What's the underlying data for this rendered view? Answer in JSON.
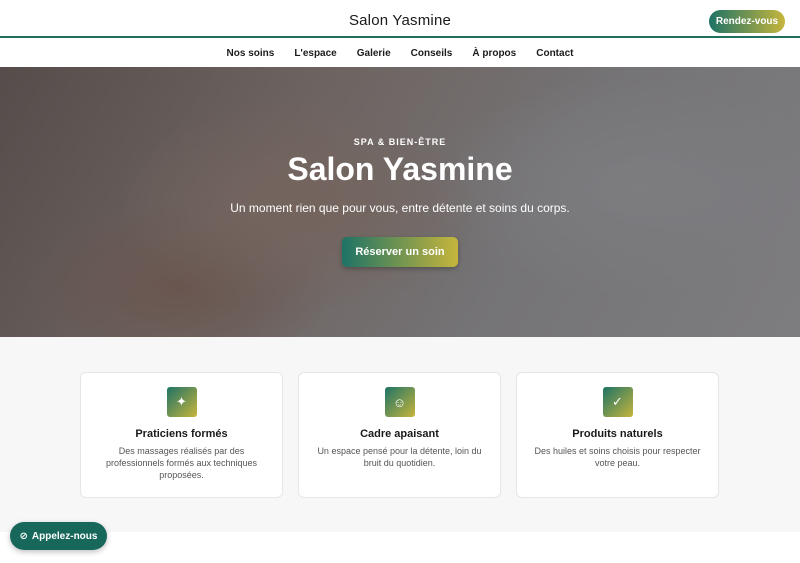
{
  "header": {
    "brand": "Salon Yasmine",
    "cta_label": "Rendez-vous"
  },
  "nav": {
    "items": [
      {
        "label": "Nos soins"
      },
      {
        "label": "L'espace"
      },
      {
        "label": "Galerie"
      },
      {
        "label": "Conseils"
      },
      {
        "label": "À propos"
      },
      {
        "label": "Contact"
      }
    ]
  },
  "hero": {
    "eyebrow": "SPA & BIEN-ÊTRE",
    "title": "Salon Yasmine",
    "subtitle": "Un moment rien que pour vous, entre détente et soins du corps.",
    "button_label": "Réserver un soin"
  },
  "features": [
    {
      "icon": "sparkle-icon",
      "glyph": "✦",
      "title": "Praticiens formés",
      "text": "Des massages réalisés par des professionnels formés aux techniques proposées."
    },
    {
      "icon": "smiley-icon",
      "glyph": "☺",
      "title": "Cadre apaisant",
      "text": "Un espace pensé pour la détente, loin du bruit du quotidien."
    },
    {
      "icon": "checkmark-icon",
      "glyph": "✓",
      "title": "Produits naturels",
      "text": "Des huiles et soins choisis pour respecter votre peau."
    }
  ],
  "call_button": {
    "icon": "phone-icon",
    "glyph": "⊘",
    "label": "Appelez-nous"
  },
  "colors": {
    "accent_dark": "#1e7366",
    "accent_gold": "#c6b53c"
  }
}
